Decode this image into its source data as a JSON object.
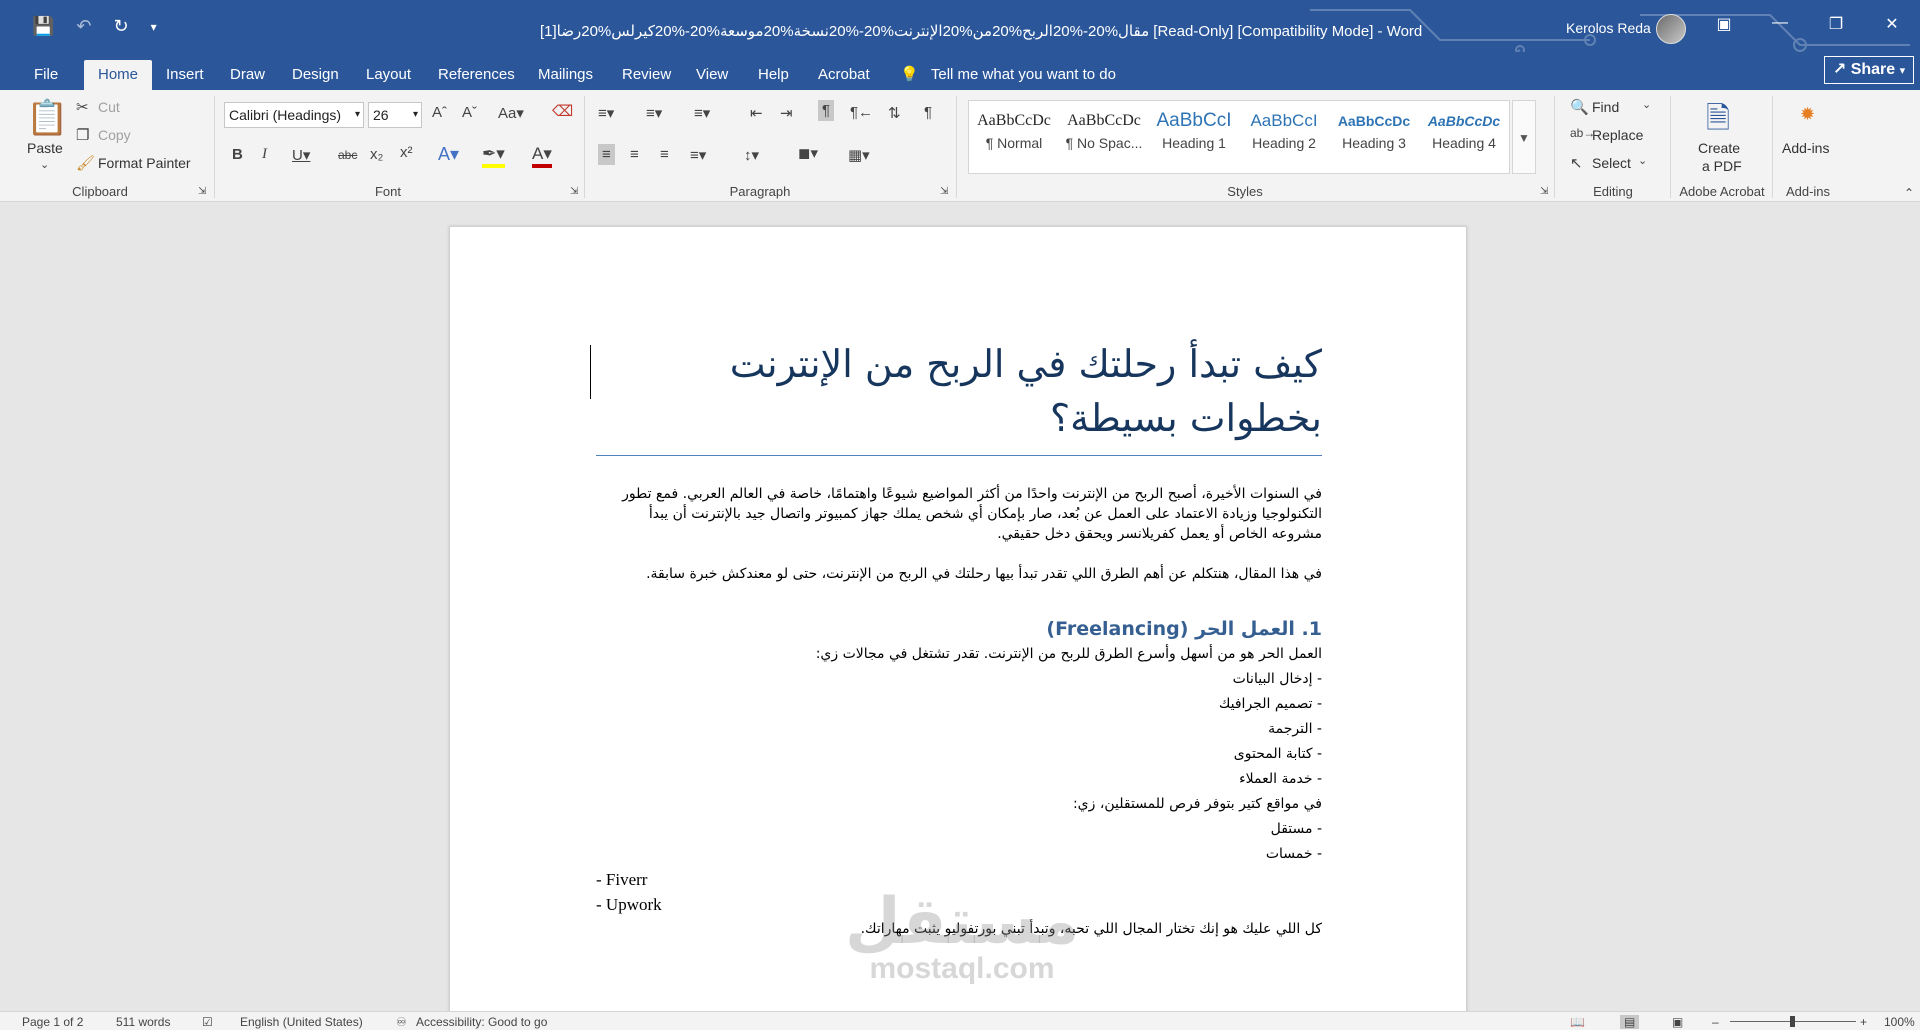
{
  "titlebar": {
    "title": "مقال%20-%20الربح%20من%20الإنترنت%20-%20نسخة%20موسعة%20-%20كيرلس%20رضا[1] [Read-Only] [Compatibility Mode]  -  Word",
    "user": "Kerolos Reda",
    "icons": [
      "save-icon",
      "undo-icon",
      "redo-icon",
      "customize-qat-icon",
      "ribbon-display-icon",
      "minimize-icon",
      "restore-icon",
      "close-icon"
    ]
  },
  "tabs": [
    "File",
    "Home",
    "Insert",
    "Draw",
    "Design",
    "Layout",
    "References",
    "Mailings",
    "Review",
    "View",
    "Help",
    "Acrobat"
  ],
  "tell_me": "Tell me what you want to do",
  "share_label": "Share",
  "clipboard": {
    "paste": "Paste",
    "cut": "Cut",
    "copy": "Copy",
    "format_painter": "Format Painter",
    "label": "Clipboard"
  },
  "font": {
    "name": "Calibri (Headings)",
    "size": "26",
    "label": "Font"
  },
  "paragraph": {
    "label": "Paragraph"
  },
  "styles": {
    "label": "Styles",
    "items": [
      {
        "preview": "AaBbCcDc",
        "name": "¶ Normal"
      },
      {
        "preview": "AaBbCcDc",
        "name": "¶ No Spac..."
      },
      {
        "preview": "AaBbCcI",
        "name": "Heading 1"
      },
      {
        "preview": "AaBbCcI",
        "name": "Heading 2"
      },
      {
        "preview": "AaBbCcDc",
        "name": "Heading 3"
      },
      {
        "preview": "AaBbCcDc",
        "name": "Heading 4"
      }
    ]
  },
  "editing": {
    "find": "Find",
    "replace": "Replace",
    "select": "Select",
    "label": "Editing"
  },
  "acrobat": {
    "create": "Create",
    "create2": "a PDF",
    "label": "Adobe Acrobat"
  },
  "addins": {
    "button": "Add-ins",
    "label": "Add-ins"
  },
  "document": {
    "title": "كيف تبدأ رحلتك في الربح من الإنترنت بخطوات بسيطة؟",
    "intro": "في السنوات الأخيرة، أصبح الربح من الإنترنت واحدًا من أكثر المواضيع شيوعًا واهتمامًا، خاصة في العالم العربي. فمع تطور التكنولوجيا وزيادة الاعتماد على العمل عن بُعد، صار بإمكان أي شخص يملك جهاز كمبيوتر واتصال جيد بالإنترنت أن يبدأ مشروعه الخاص أو يعمل كفريلانسر ويحقق دخل حقيقي.",
    "intro2": "في هذا المقال، هنتكلم عن أهم الطرق اللي تقدر تبدأ بيها رحلتك في الربح من الإنترنت، حتى لو معندكش خبرة سابقة.",
    "h1": "1. العمل الحر (Freelancing)",
    "h1_intro": "العمل الحر هو من أسهل وأسرع الطرق للربح من الإنترنت. تقدر تشتغل في مجالات زي:",
    "fields": [
      "- إدخال البيانات",
      "- تصميم الجرافيك",
      "- الترجمة",
      "- كتابة المحتوى",
      "- خدمة العملاء"
    ],
    "sites_intro": "في مواقع كتير بتوفر فرص للمستقلين، زي:",
    "sites_ar": [
      "- مستقل",
      "- خمسات"
    ],
    "sites_en": [
      "- Fiverr",
      "- Upwork"
    ],
    "closing": "كل اللي عليك هو إنك تختار المجال اللي تحبه، وتبدأ تبني بورتفوليو يثبت مهاراتك."
  },
  "watermark": {
    "ar": "مستقل",
    "en": "mostaql.com"
  },
  "status": {
    "page": "Page 1 of 2",
    "words": "511 words",
    "language": "English (United States)",
    "accessibility": "Accessibility: Good to go",
    "zoom": "100%"
  }
}
